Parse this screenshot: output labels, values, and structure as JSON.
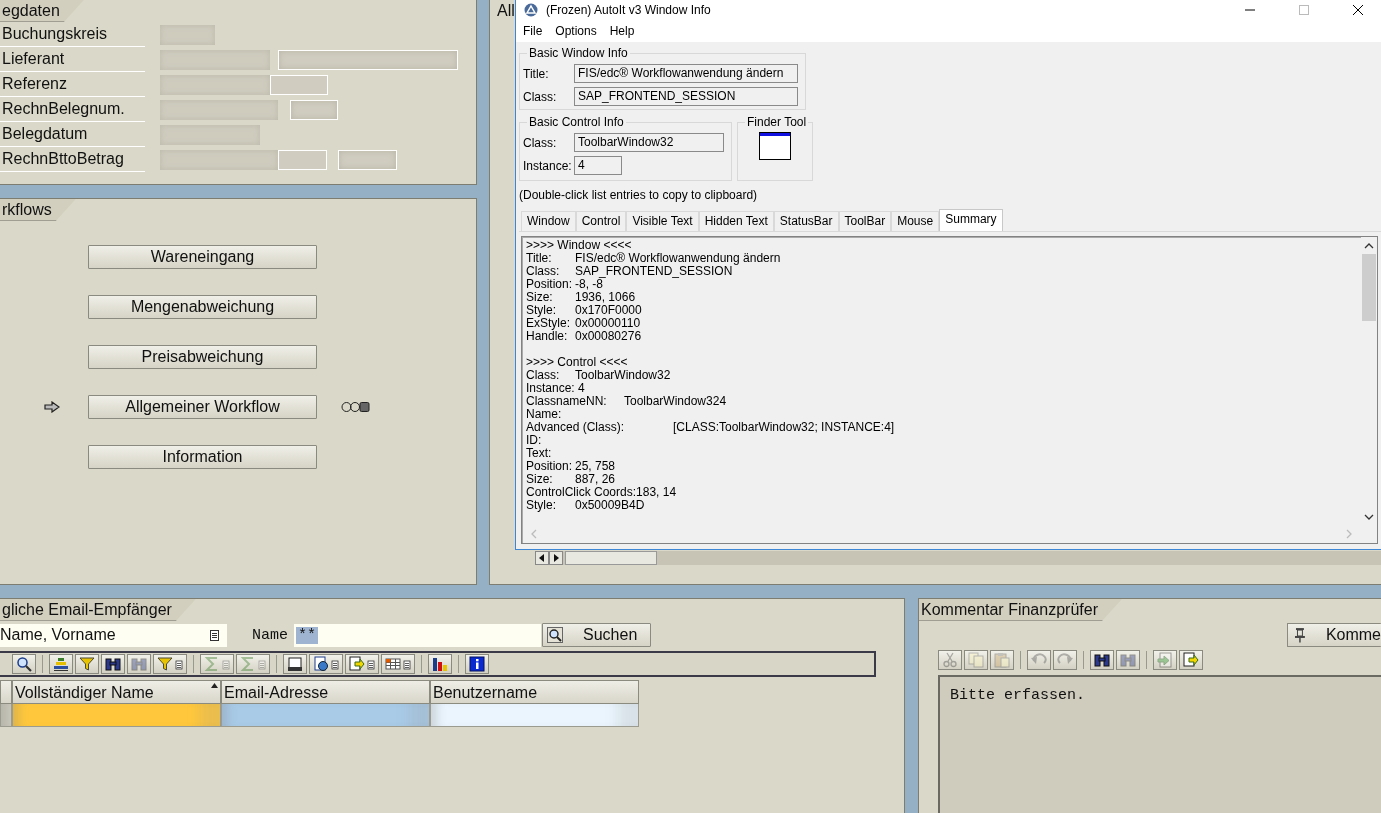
{
  "sap": {
    "document_panel": {
      "tab": "egdaten",
      "fields": [
        {
          "label": "Buchungskreis"
        },
        {
          "label": "Lieferant"
        },
        {
          "label": "Referenz"
        },
        {
          "label": "RechnBelegnum."
        },
        {
          "label": "Belegdatum"
        },
        {
          "label": "RechnBttoBetrag"
        }
      ]
    },
    "workflow_panel": {
      "tab": "rkflows",
      "buttons": [
        {
          "label": "Wareneingang",
          "current": false,
          "indicator": false
        },
        {
          "label": "Mengenabweichung",
          "current": false,
          "indicator": false
        },
        {
          "label": "Preisabweichung",
          "current": false,
          "indicator": false
        },
        {
          "label": "Allgemeiner Workflow",
          "current": true,
          "indicator": true
        },
        {
          "label": "Information",
          "current": false,
          "indicator": false
        }
      ]
    },
    "right_panel": {
      "tab": "All"
    },
    "recipients_panel": {
      "tab": "gliche Email-Empfänger",
      "search_by": {
        "value": "Name, Vorname"
      },
      "name_label": "Name",
      "name_field": {
        "value": "**",
        "highlighted": true
      },
      "search_button": "Suchen",
      "toolbar": [
        {
          "disabled": false,
          "menu": false,
          "separated": false
        },
        {
          "disabled": false,
          "menu": false,
          "separated": true
        },
        {
          "disabled": false,
          "menu": false,
          "separated": false
        },
        {
          "disabled": false,
          "menu": false,
          "separated": false
        },
        {
          "disabled": true,
          "menu": false,
          "separated": false
        },
        {
          "disabled": false,
          "menu": true,
          "separated": false
        },
        {
          "disabled": true,
          "menu": true,
          "separated": true
        },
        {
          "disabled": true,
          "menu": true,
          "separated": false
        },
        {
          "disabled": false,
          "menu": false,
          "separated": true
        },
        {
          "disabled": false,
          "menu": true,
          "separated": false
        },
        {
          "disabled": false,
          "menu": true,
          "separated": false
        },
        {
          "disabled": false,
          "menu": true,
          "separated": false
        },
        {
          "disabled": false,
          "menu": false,
          "separated": true
        },
        {
          "disabled": false,
          "menu": false,
          "separated": true
        }
      ],
      "columns": [
        {
          "label": "Vollständiger Name",
          "sorted": true
        },
        {
          "label": "Email-Adresse",
          "sorted": false
        },
        {
          "label": "Benutzername",
          "sorted": false
        }
      ],
      "rows": [
        {
          "cells": [
            {
              "color": "#ffc83c"
            },
            {
              "color": "#a9cbe8"
            },
            {
              "color": "#eaf5fd"
            }
          ]
        }
      ]
    },
    "comment_panel": {
      "tab": "Kommentar Finanzprüfer",
      "button": "Komme",
      "text": "Bitte erfassen.",
      "toolbar": [
        {
          "disabled": true,
          "separated": false
        },
        {
          "disabled": true,
          "separated": false
        },
        {
          "disabled": true,
          "separated": false
        },
        {
          "disabled": true,
          "separated": true
        },
        {
          "disabled": true,
          "separated": false
        },
        {
          "disabled": false,
          "separated": true
        },
        {
          "disabled": true,
          "separated": false
        },
        {
          "disabled": true,
          "separated": true
        },
        {
          "disabled": false,
          "separated": false
        }
      ]
    }
  },
  "autoit": {
    "title": "(Frozen) AutoIt v3 Window Info",
    "menu": [
      "File",
      "Options",
      "Help"
    ],
    "basic_window": {
      "title": "Basic Window Info",
      "fields": [
        {
          "label": "Title:",
          "value": "FIS/edc® Workflowanwendung ändern"
        },
        {
          "label": "Class:",
          "value": "SAP_FRONTEND_SESSION"
        }
      ]
    },
    "basic_control": {
      "title": "Basic Control Info",
      "fields": [
        {
          "label": "Class:",
          "value": "ToolbarWindow32"
        },
        {
          "label": "Instance:",
          "value": "4"
        }
      ]
    },
    "finder": {
      "title": "Finder Tool"
    },
    "hint": "(Double-click list entries to copy to clipboard)",
    "tabs": [
      {
        "label": "Window",
        "selected": false
      },
      {
        "label": "Control",
        "selected": false
      },
      {
        "label": "Visible Text",
        "selected": false
      },
      {
        "label": "Hidden Text",
        "selected": false
      },
      {
        "label": "StatusBar",
        "selected": false
      },
      {
        "label": "ToolBar",
        "selected": false
      },
      {
        "label": "Mouse",
        "selected": false
      },
      {
        "label": "Summary",
        "selected": true
      }
    ],
    "summary": [
      {
        "lines": [
          ">>>> Window <<<<",
          "Title:\tFIS/edc® Workflowanwendung ändern",
          "Class:\tSAP_FRONTEND_SESSION",
          "Position:\t-8, -8",
          "Size:\t1936, 1066",
          "Style:\t0x170F0000",
          "ExStyle:\t0x00000110",
          "Handle:\t0x00080276"
        ]
      },
      {
        "lines": [
          ">>>> Control <<<<",
          "Class:\tToolbarWindow32",
          "Instance: 4",
          "ClassnameNN:\tToolbarWindow324",
          "Name:",
          "Advanced (Class):\t[CLASS:ToolbarWindow32; INSTANCE:4]",
          "ID:",
          "Text:",
          "Position:\t25, 758",
          "Size:\t887, 26",
          "ControlClick Coords:183, 14",
          "Style:\t0x50009B4D"
        ]
      }
    ]
  }
}
